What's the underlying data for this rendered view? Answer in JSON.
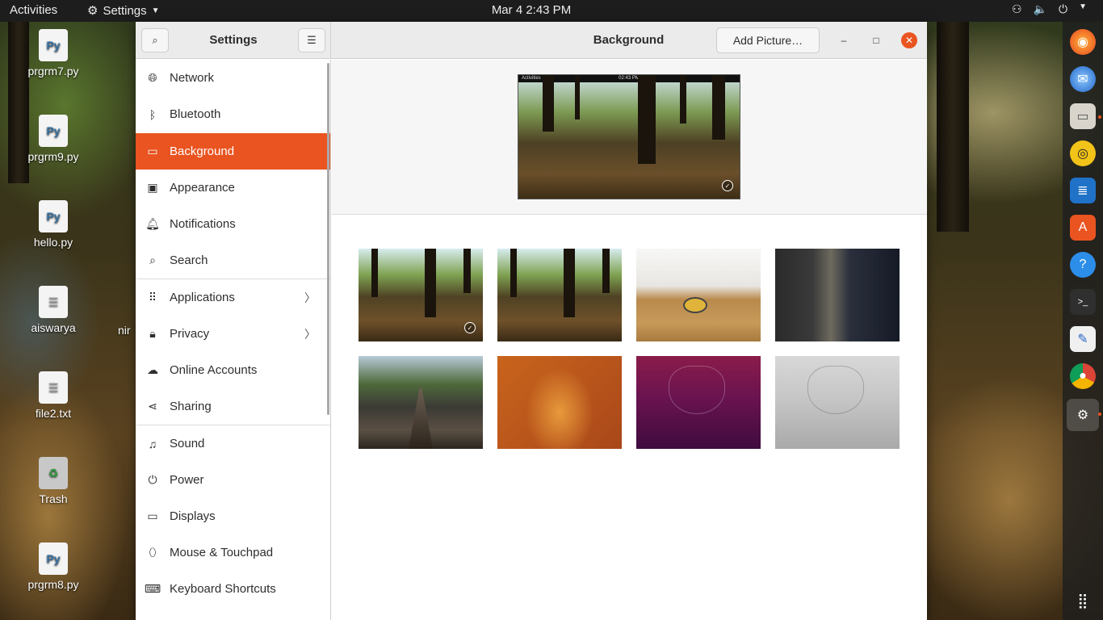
{
  "topbar": {
    "activities": "Activities",
    "app_menu": "Settings",
    "clock": "Mar 4  2:43 PM"
  },
  "desktop_icons": [
    {
      "label": "prgrm7.py",
      "icon": "python-file-icon"
    },
    {
      "label": "prgrm9.py",
      "icon": "python-file-icon"
    },
    {
      "label": "hello.py",
      "icon": "python-file-icon"
    },
    {
      "label": "aiswarya",
      "icon": "text-file-icon"
    },
    {
      "label": "file2.txt",
      "icon": "text-file-icon"
    },
    {
      "label": "Trash",
      "icon": "trash-icon"
    },
    {
      "label": "prgrm8.py",
      "icon": "python-file-icon"
    }
  ],
  "partial_label": "nir",
  "dock": [
    "firefox-icon",
    "thunderbird-icon",
    "files-icon",
    "rhythmbox-icon",
    "writer-icon",
    "software-icon",
    "help-icon",
    "terminal-icon",
    "text-editor-icon",
    "chrome-icon",
    "settings-icon",
    "show-apps-icon"
  ],
  "window": {
    "sidebar_title": "Settings",
    "content_title": "Background",
    "add_picture": "Add Picture…"
  },
  "sidebar": {
    "items": [
      {
        "label": "Network",
        "icon": "network-icon"
      },
      {
        "label": "Bluetooth",
        "icon": "bluetooth-icon"
      },
      {
        "label": "Background",
        "icon": "background-icon",
        "active": true
      },
      {
        "label": "Appearance",
        "icon": "appearance-icon"
      },
      {
        "label": "Notifications",
        "icon": "bell-icon"
      },
      {
        "label": "Search",
        "icon": "search-icon"
      },
      {
        "label": "Applications",
        "icon": "apps-grid-icon",
        "chevron": true
      },
      {
        "label": "Privacy",
        "icon": "lock-icon",
        "chevron": true
      },
      {
        "label": "Online Accounts",
        "icon": "cloud-icon"
      },
      {
        "label": "Sharing",
        "icon": "share-icon"
      },
      {
        "label": "Sound",
        "icon": "music-note-icon"
      },
      {
        "label": "Power",
        "icon": "power-icon"
      },
      {
        "label": "Displays",
        "icon": "display-icon"
      },
      {
        "label": "Mouse & Touchpad",
        "icon": "mouse-icon"
      },
      {
        "label": "Keyboard Shortcuts",
        "icon": "keyboard-icon"
      }
    ]
  },
  "preview": {
    "bar_left": "Activities",
    "bar_center": "02:43 PM"
  },
  "wallpapers": [
    {
      "name": "forest-trees",
      "selected": true
    },
    {
      "name": "forest-trees-alt",
      "selected": false
    },
    {
      "name": "shuffleboard",
      "selected": false
    },
    {
      "name": "subway-corridor",
      "selected": false
    },
    {
      "name": "suspension-bridge",
      "selected": false
    },
    {
      "name": "orange-bird-abstract",
      "selected": false
    },
    {
      "name": "purple-fossa",
      "selected": false
    },
    {
      "name": "grey-fossa",
      "selected": false
    }
  ],
  "colors": {
    "accent": "#e95420",
    "topbar": "#1d1d1d",
    "header": "#ebebeb"
  }
}
